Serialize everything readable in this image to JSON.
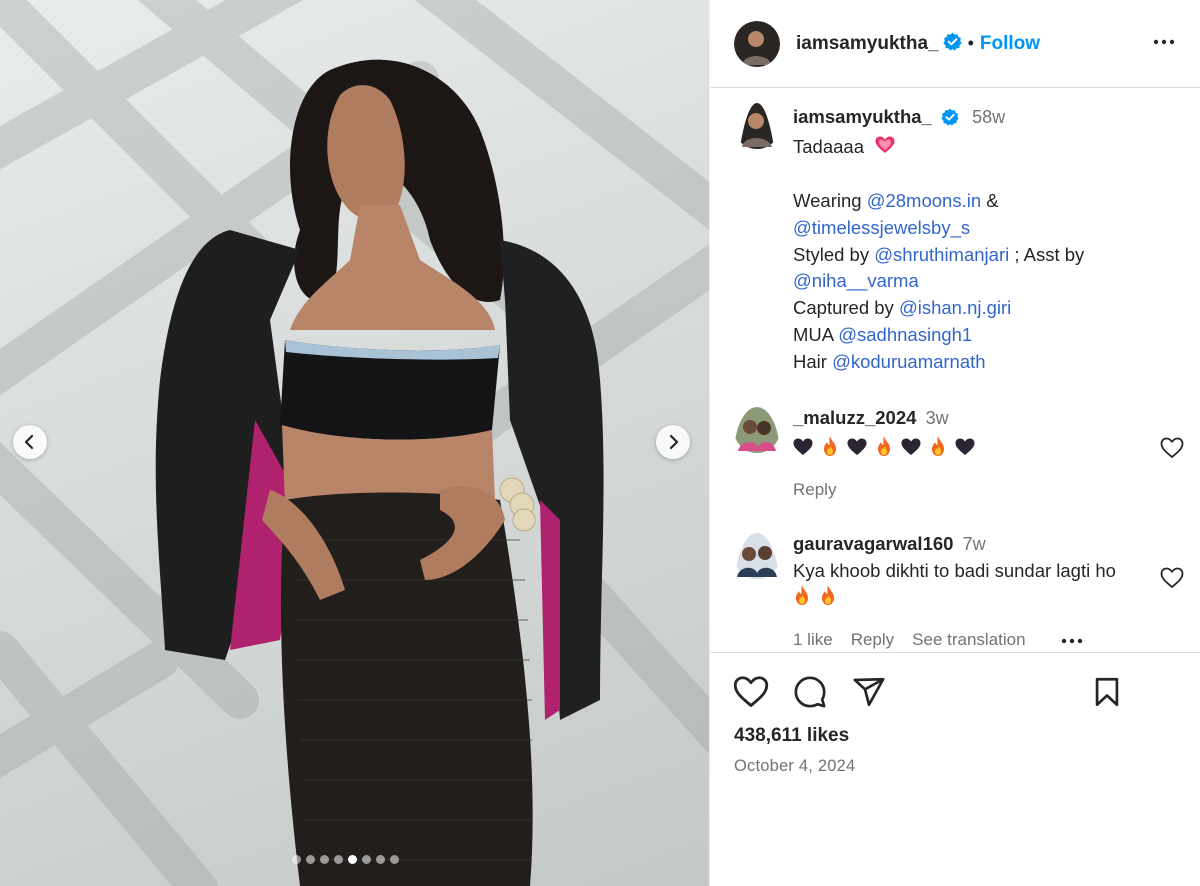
{
  "post": {
    "username": "iamsamyuktha_",
    "follow_label": "Follow",
    "separator": "•",
    "caption": {
      "time": "58w",
      "line1": "Tadaaaa",
      "wearing_prefix": "Wearing ",
      "wearing_mention": "@28moons.in",
      "amp": " &",
      "jewels_mention": "@timelessjewelsby_s",
      "styled_prefix": "Styled by ",
      "styled_mention": "@shruthimanjari",
      "asst_prefix": " ; Asst by",
      "asst_mention": "@niha__varma",
      "captured_prefix": "Captured by ",
      "captured_mention": "@ishan.nj.giri",
      "mua_prefix": "MUA ",
      "mua_mention": "@sadhnasingh1",
      "hair_prefix": "Hair ",
      "hair_mention": "@koduruamarnath"
    },
    "comments": [
      {
        "username": "_maluzz_2024",
        "time": "3w",
        "emojis": [
          "black-heart",
          "fire",
          "black-heart",
          "fire",
          "black-heart",
          "fire",
          "black-heart"
        ],
        "reply_label": "Reply"
      },
      {
        "username": "gauravagarwal160",
        "time": "7w",
        "text": "Kya khoob dikhti to badi sundar lagti ho",
        "emojis": [
          "fire",
          "fire"
        ],
        "likes_label": "1 like",
        "reply_label": "Reply",
        "translate_label": "See translation"
      }
    ],
    "likes": "438,611 likes",
    "date": "October 4, 2024"
  },
  "carousel": {
    "slides": 8,
    "active_index": 4
  },
  "colors": {
    "link": "#0095f6",
    "mention": "#3366cc",
    "muted": "#737373"
  }
}
